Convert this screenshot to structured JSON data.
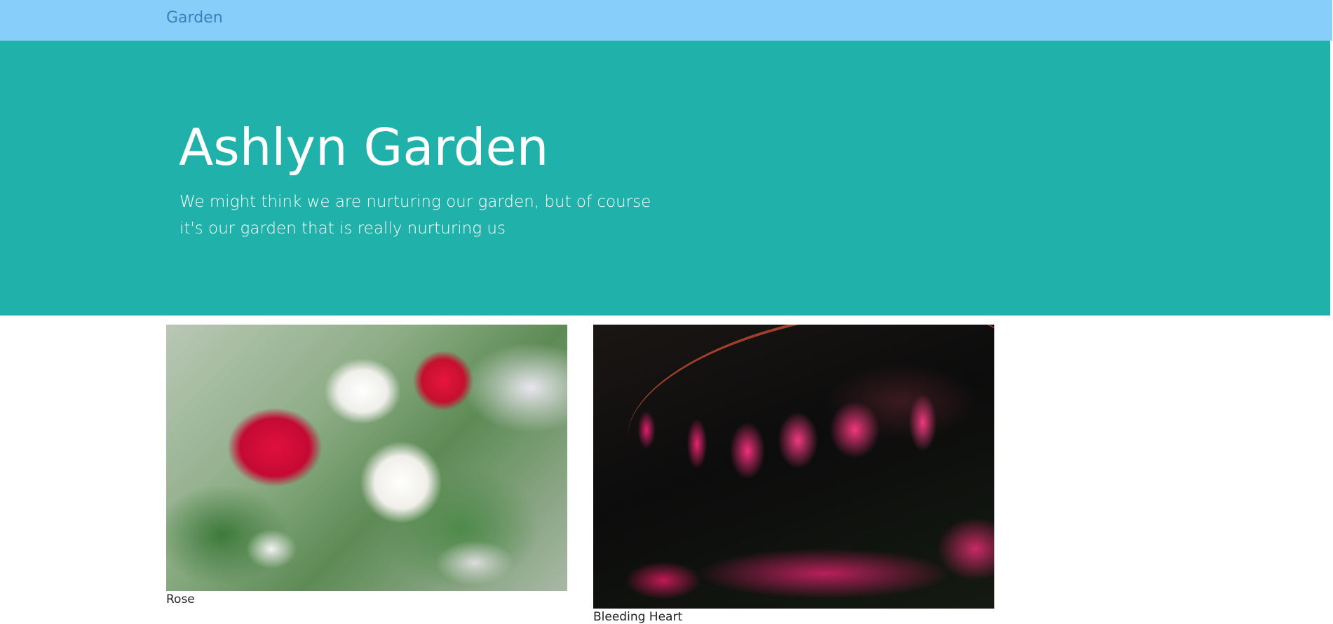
{
  "navbar": {
    "brand": "Garden",
    "background_color": "#87cefa",
    "brand_color": "#3a7fc0"
  },
  "hero": {
    "title": "Ashlyn Garden",
    "tagline": "We might think we are nurturing our garden, but of course it's our garden that is really nurturing us",
    "background_color": "#20b2aa",
    "text_color": "#ffffff"
  },
  "gallery": {
    "items": [
      {
        "image_subject": "red and white roses with baby's breath",
        "caption": "Rose"
      },
      {
        "image_subject": "pink bleeding heart flowers on a stem",
        "caption": "Bleeding Heart"
      }
    ]
  }
}
